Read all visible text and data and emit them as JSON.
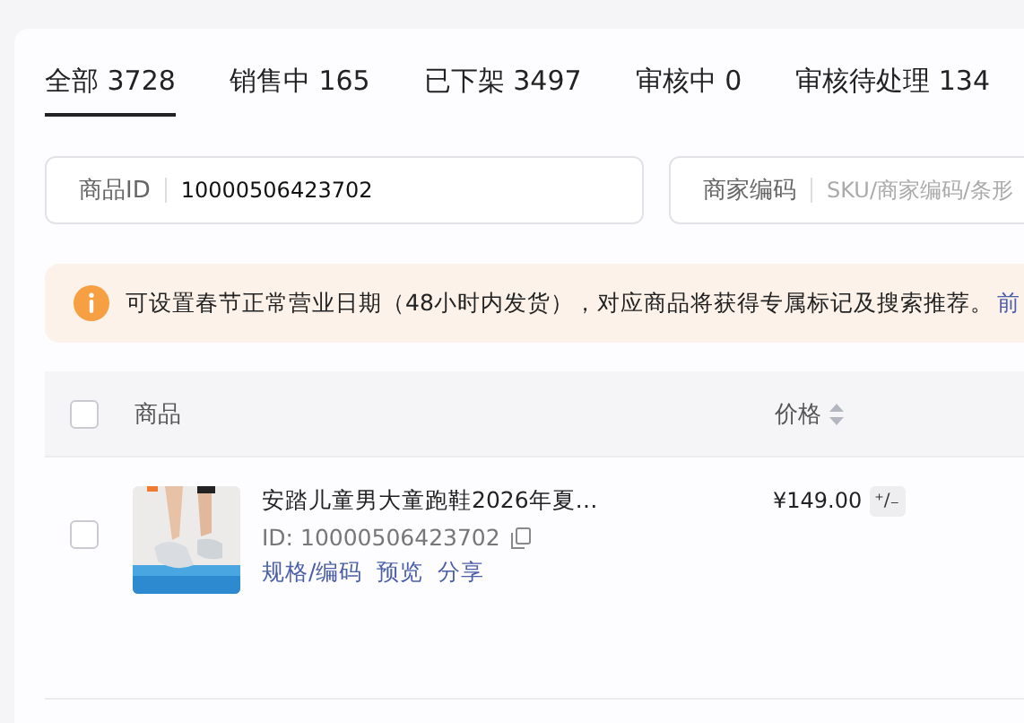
{
  "tabs": [
    {
      "label": "全部 3728",
      "selected": true
    },
    {
      "label": "销售中 165",
      "selected": false
    },
    {
      "label": "已下架 3497",
      "selected": false
    },
    {
      "label": "审核中 0",
      "selected": false
    },
    {
      "label": "审核待处理 134",
      "selected": false
    }
  ],
  "filters": [
    {
      "label": "商品ID",
      "value": "10000506423702"
    },
    {
      "label": "商家编码",
      "placeholder": "SKU/商家编码/条形"
    }
  ],
  "notice": {
    "text": "可设置春节正常营业日期（48小时内发货），对应商品将获得专属标记及搜索推荐。",
    "link": "前"
  },
  "table": {
    "header_checked": false,
    "columns": [
      "商品",
      "价格"
    ],
    "rows": [
      {
        "checked": false,
        "title": "安踏儿童男大童跑鞋2026年夏…",
        "id": "ID: 10000506423702",
        "actions": [
          "规格/编码",
          "预览",
          "分享"
        ],
        "price": "¥149.00",
        "price_edit": "⁺∕₋"
      }
    ]
  }
}
